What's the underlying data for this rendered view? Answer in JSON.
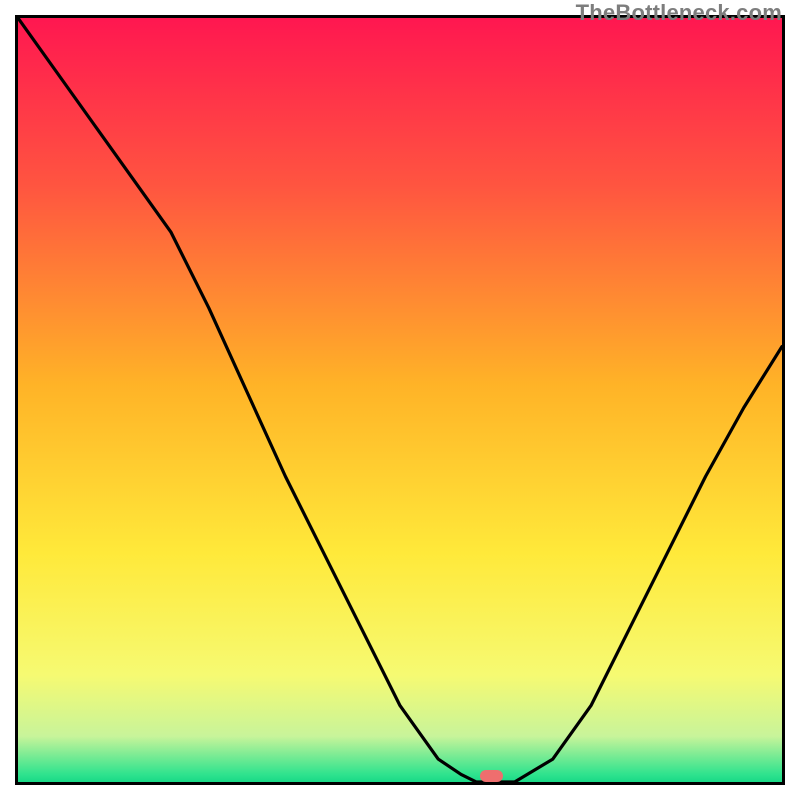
{
  "watermark": "TheBottleneck.com",
  "chart_data": {
    "type": "line",
    "title": "",
    "xlabel": "",
    "ylabel": "",
    "xlim": [
      0,
      100
    ],
    "ylim": [
      0,
      100
    ],
    "x": [
      0,
      5,
      10,
      15,
      20,
      25,
      30,
      35,
      40,
      45,
      50,
      55,
      58,
      60,
      62,
      65,
      70,
      75,
      80,
      85,
      90,
      95,
      100
    ],
    "values": [
      100,
      93,
      86,
      79,
      72,
      62,
      51,
      40,
      30,
      20,
      10,
      3,
      1,
      0,
      0,
      0,
      3,
      10,
      20,
      30,
      40,
      49,
      57
    ],
    "optimum_marker": {
      "x": 62,
      "width": 3
    },
    "gradient_stops": [
      {
        "pct": 0,
        "color": "#ff1750"
      },
      {
        "pct": 22,
        "color": "#ff5540"
      },
      {
        "pct": 48,
        "color": "#ffb327"
      },
      {
        "pct": 70,
        "color": "#ffe93a"
      },
      {
        "pct": 86,
        "color": "#f6fa72"
      },
      {
        "pct": 94,
        "color": "#c8f49a"
      },
      {
        "pct": 99,
        "color": "#2fe38e"
      },
      {
        "pct": 100,
        "color": "#19d987"
      }
    ]
  }
}
